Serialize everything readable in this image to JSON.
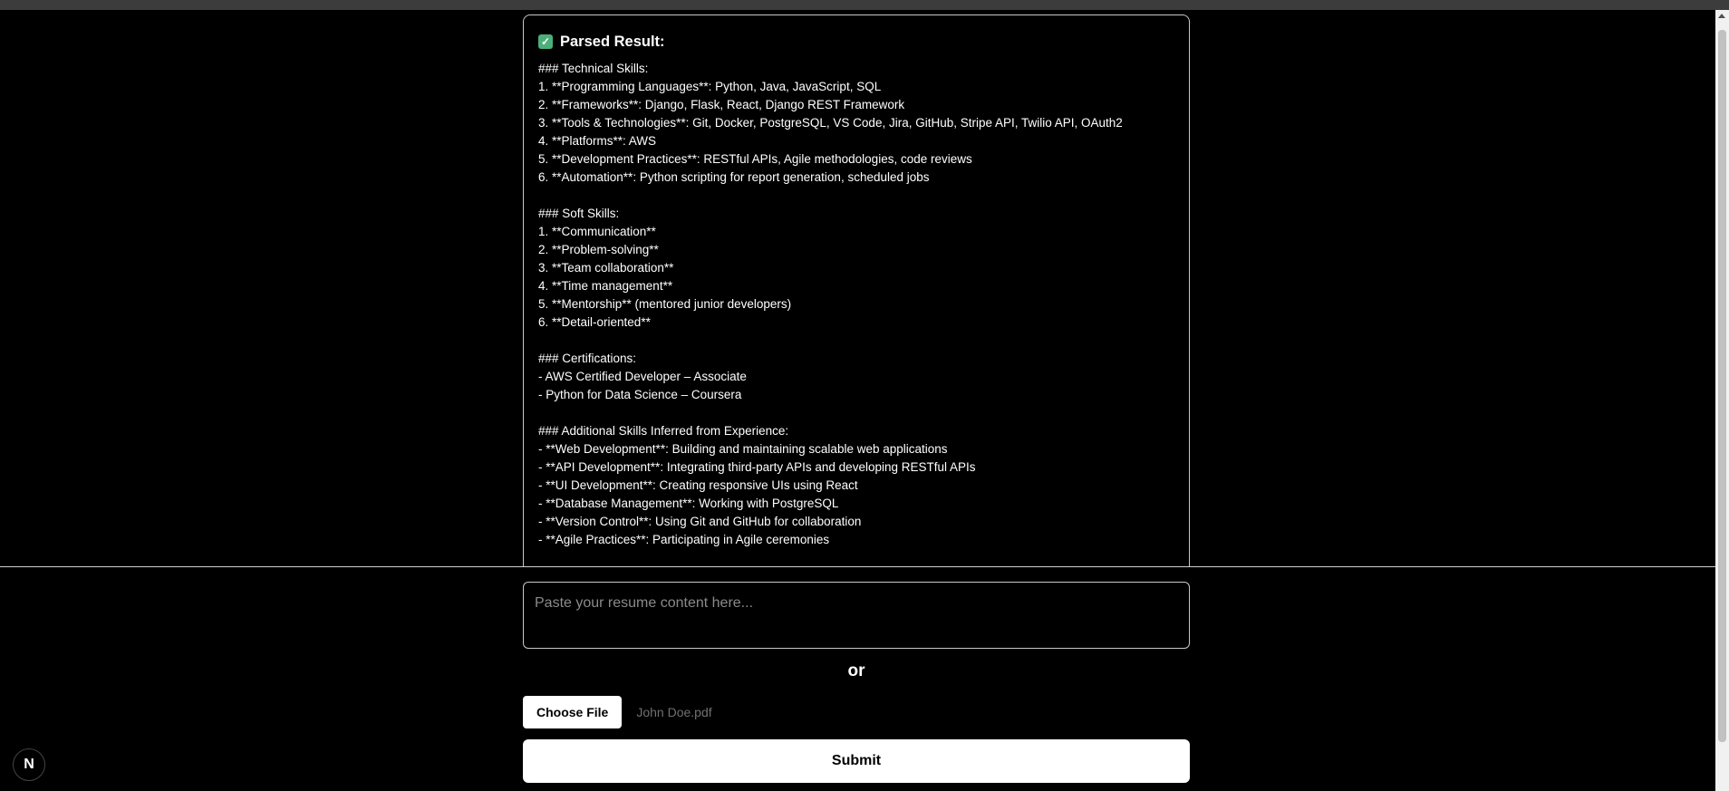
{
  "result": {
    "check_glyph": "✓",
    "title": "Parsed Result:",
    "content": "### Technical Skills:\n1. **Programming Languages**: Python, Java, JavaScript, SQL\n2. **Frameworks**: Django, Flask, React, Django REST Framework\n3. **Tools & Technologies**: Git, Docker, PostgreSQL, VS Code, Jira, GitHub, Stripe API, Twilio API, OAuth2\n4. **Platforms**: AWS\n5. **Development Practices**: RESTful APIs, Agile methodologies, code reviews\n6. **Automation**: Python scripting for report generation, scheduled jobs\n\n### Soft Skills:\n1. **Communication**\n2. **Problem-solving**\n3. **Team collaboration**\n4. **Time management**\n5. **Mentorship** (mentored junior developers)\n6. **Detail-oriented**\n\n### Certifications:\n- AWS Certified Developer – Associate\n- Python for Data Science – Coursera\n\n### Additional Skills Inferred from Experience:\n- **Web Development**: Building and maintaining scalable web applications\n- **API Development**: Integrating third-party APIs and developing RESTful APIs\n- **UI Development**: Creating responsive UIs using React\n- **Database Management**: Working with PostgreSQL\n- **Version Control**: Using Git and GitHub for collaboration\n- **Agile Practices**: Participating in Agile ceremonies"
  },
  "form": {
    "resume_placeholder": "Paste your resume content here...",
    "resume_value": "",
    "or_text": "or",
    "choose_file_label": "Choose File",
    "file_name": "John Doe.pdf",
    "submit_label": "Submit"
  },
  "badge": {
    "letter": "N"
  },
  "colors": {
    "background": "#000000",
    "accent_check": "#4caf7a",
    "button_bg": "#ffffff"
  }
}
